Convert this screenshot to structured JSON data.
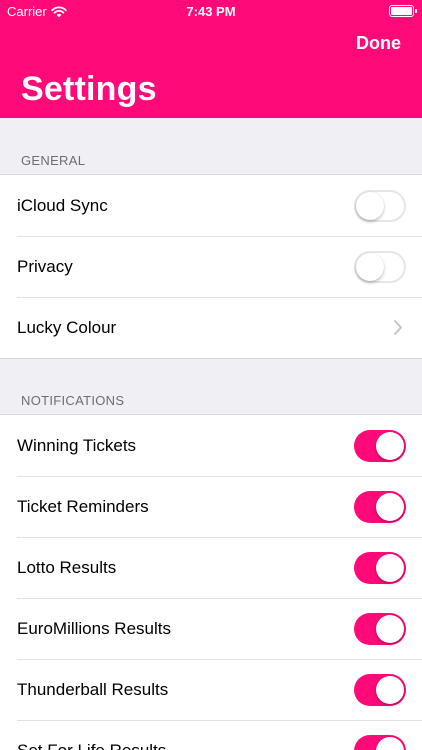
{
  "status_bar": {
    "carrier": "Carrier",
    "time": "7:43 PM"
  },
  "nav": {
    "done_label": "Done",
    "title": "Settings"
  },
  "colors": {
    "accent": "#ff0a78",
    "background": "#efeff4"
  },
  "general": {
    "header": "GENERAL",
    "icloud_sync": {
      "label": "iCloud Sync",
      "enabled": false
    },
    "privacy": {
      "label": "Privacy",
      "enabled": false
    },
    "lucky_colour": {
      "label": "Lucky Colour"
    }
  },
  "notifications": {
    "header": "NOTIFICATIONS",
    "winning_tickets": {
      "label": "Winning Tickets",
      "enabled": true
    },
    "ticket_reminders": {
      "label": "Ticket Reminders",
      "enabled": true
    },
    "lotto_results": {
      "label": "Lotto Results",
      "enabled": true
    },
    "euromillions_results": {
      "label": "EuroMillions Results",
      "enabled": true
    },
    "thunderball_results": {
      "label": "Thunderball Results",
      "enabled": true
    },
    "set_for_life_results": {
      "label": "Set For Life Results",
      "enabled": true
    }
  }
}
